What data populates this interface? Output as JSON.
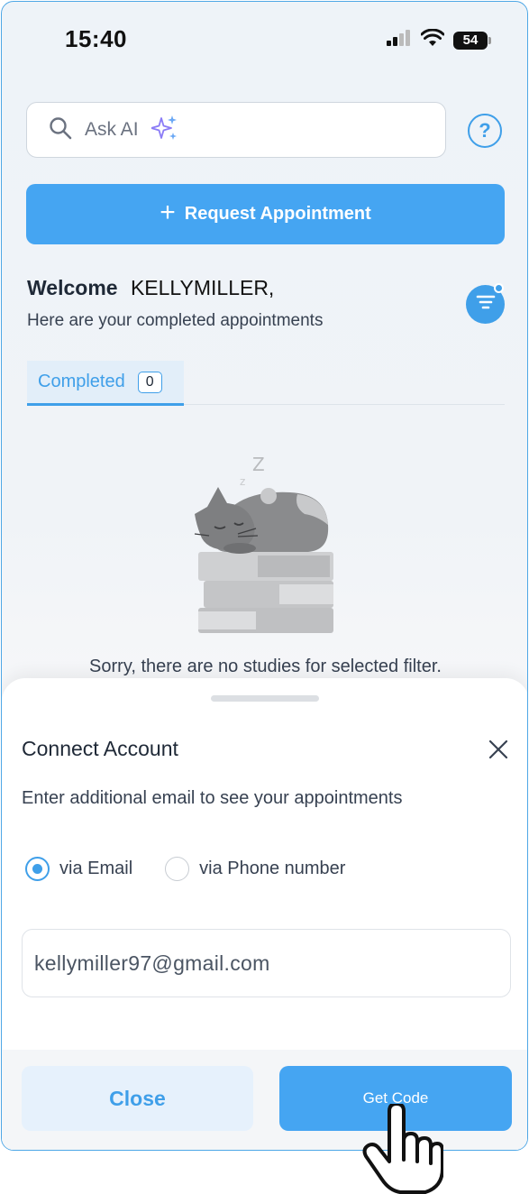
{
  "status_bar": {
    "time": "15:40",
    "battery": "54"
  },
  "search": {
    "placeholder": "Ask AI"
  },
  "help": {
    "label": "?"
  },
  "request_button": {
    "label": "Request Appointment"
  },
  "welcome": {
    "greeting": "Welcome",
    "name": "KELLYMILLER,",
    "subtitle": "Here are your completed appointments"
  },
  "tabs": [
    {
      "label": "Completed",
      "count": "0"
    }
  ],
  "empty_state": {
    "message": "Sorry, there are no studies for selected filter."
  },
  "sheet": {
    "title": "Connect Account",
    "description": "Enter additional email to see your appointments",
    "options": [
      {
        "label": "via Email",
        "selected": true
      },
      {
        "label": "via Phone number",
        "selected": false
      }
    ],
    "email_value": "kellymiller97@gmail.com",
    "close_label": "Close",
    "get_code_label": "Get Code"
  },
  "colors": {
    "accent": "#45a5f2",
    "accent_dark": "#3f9fe9",
    "tab_bg": "#e2eef9"
  },
  "icons": [
    "signal-icon",
    "wifi-icon",
    "battery-icon",
    "search-icon",
    "sparkle-icon",
    "help-icon",
    "plus-icon",
    "filter-icon",
    "sleeping-cat-illustration",
    "close-icon",
    "hand-pointer-icon"
  ]
}
